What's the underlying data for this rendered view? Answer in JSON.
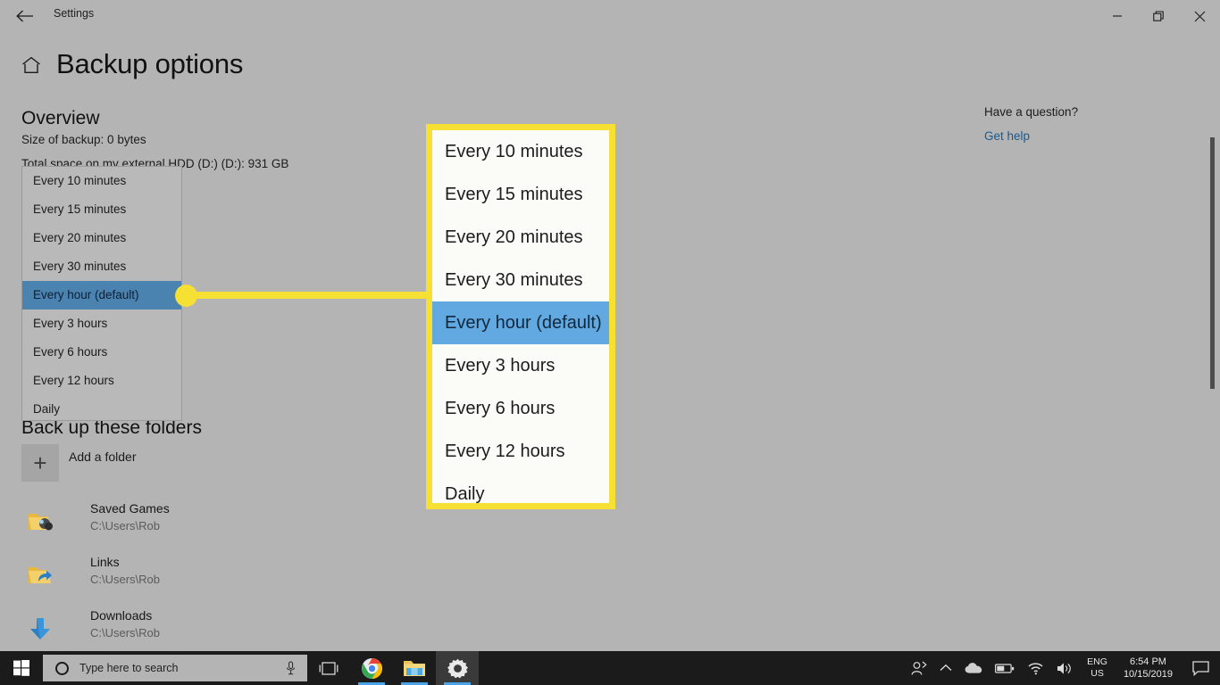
{
  "window": {
    "app_title": "Settings",
    "back_icon": "back-arrow-icon",
    "minimize_label": "—",
    "restore_label": "❐",
    "close_label": "✕"
  },
  "header": {
    "home_icon": "home-icon",
    "page_title": "Backup options"
  },
  "overview": {
    "heading": "Overview",
    "size_of_backup": "Size of backup: 0 bytes",
    "total_space": "Total space on my external HDD (D:) (D:): 931 GB"
  },
  "frequency_dropdown": {
    "options": [
      "Every 10 minutes",
      "Every 15 minutes",
      "Every 20 minutes",
      "Every 30 minutes",
      "Every hour (default)",
      "Every 3 hours",
      "Every 6 hours",
      "Every 12 hours",
      "Daily"
    ],
    "selected_index": 4,
    "selected_value": "Every hour (default)"
  },
  "callout": {
    "border_color": "#f7e034",
    "highlight_color": "#61a9e0",
    "connector_dot": "callout-anchor-dot"
  },
  "folders_section": {
    "heading": "Back up these folders",
    "add_folder": {
      "icon": "plus-icon",
      "label": "Add a folder"
    },
    "items": [
      {
        "icon": "saved-games-folder-icon",
        "name": "Saved Games",
        "path": "C:\\Users\\Rob"
      },
      {
        "icon": "links-folder-icon",
        "name": "Links",
        "path": "C:\\Users\\Rob"
      },
      {
        "icon": "downloads-arrow-icon",
        "name": "Downloads",
        "path": "C:\\Users\\Rob"
      }
    ]
  },
  "help": {
    "title": "Have a question?",
    "link": "Get help",
    "link_color": "#1b5a8f"
  },
  "taskbar": {
    "start_icon": "windows-start-icon",
    "search_placeholder": "Type here to search",
    "search_icon": "cortana-circle-icon",
    "mic_icon": "microphone-icon",
    "buttons": [
      {
        "icon": "task-view-icon",
        "name": "task-view",
        "active": false,
        "running": false
      },
      {
        "icon": "chrome-icon",
        "name": "google-chrome",
        "active": false,
        "running": true
      },
      {
        "icon": "file-explorer-icon",
        "name": "file-explorer",
        "active": false,
        "running": true
      },
      {
        "icon": "settings-gear-icon",
        "name": "settings",
        "active": true,
        "running": true
      }
    ],
    "tray": {
      "icons": [
        "meet-now-icon",
        "show-hidden-icons-chevron",
        "onedrive-cloud-icon",
        "battery-icon",
        "wifi-icon",
        "speaker-icon"
      ],
      "language_line1": "ENG",
      "language_line2": "US",
      "time": "6:54 PM",
      "date": "10/15/2019",
      "notification_icon": "action-center-icon"
    }
  }
}
